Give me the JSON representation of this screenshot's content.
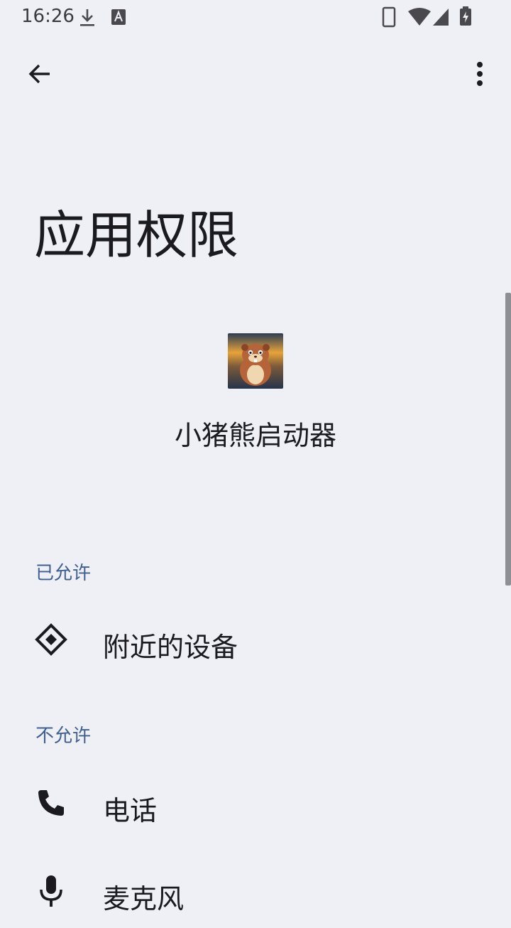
{
  "status_bar": {
    "time": "16:26",
    "icons": [
      "download-icon",
      "accessibility-a-icon",
      "phone-device-icon",
      "wifi-icon",
      "signal-icon",
      "battery-charging-icon"
    ]
  },
  "toolbar": {
    "back_icon": "arrow-left-icon",
    "more_icon": "more-vert-icon"
  },
  "page": {
    "title": "应用权限"
  },
  "app": {
    "name": "小猪熊启动器",
    "icon": "hamster-app-icon"
  },
  "sections": {
    "allowed": {
      "header": "已允许",
      "items": [
        {
          "label": "附近的设备",
          "icon": "nearby-devices-icon"
        }
      ]
    },
    "denied": {
      "header": "不允许",
      "items": [
        {
          "label": "电话",
          "icon": "phone-icon"
        },
        {
          "label": "麦克风",
          "icon": "microphone-icon"
        }
      ]
    }
  },
  "colors": {
    "background": "#eff0f6",
    "section_header": "#3f5f90",
    "text": "#1b1b1f"
  }
}
